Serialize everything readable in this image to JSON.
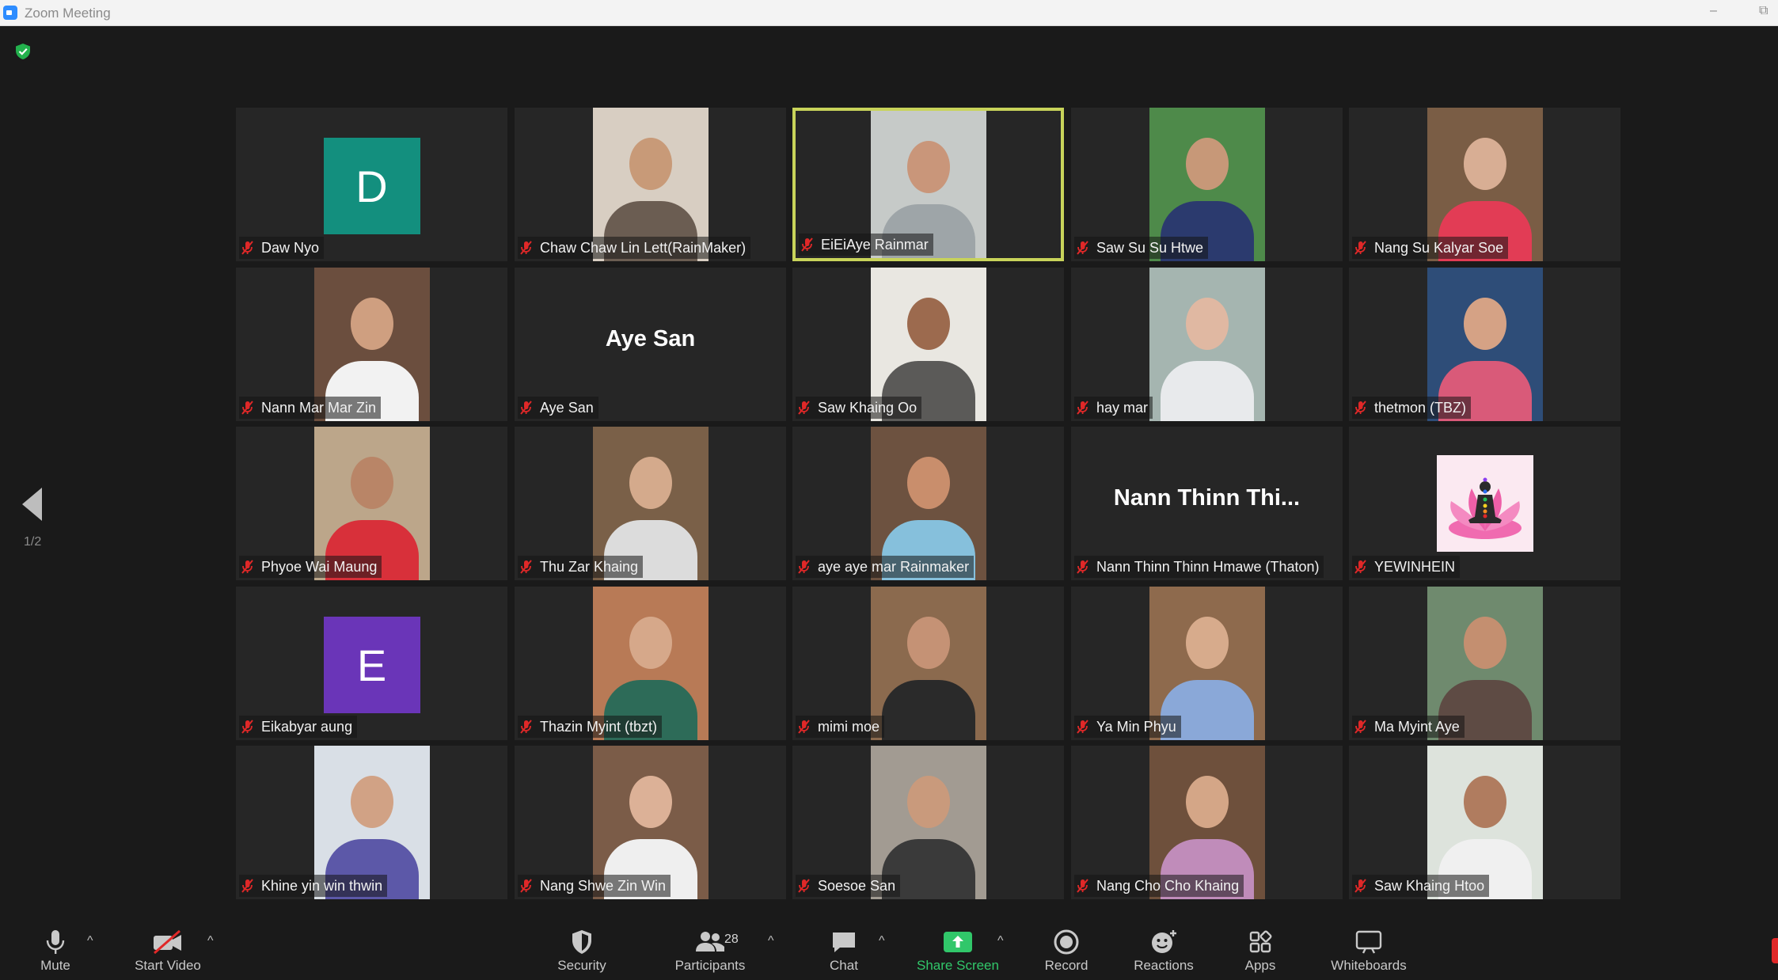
{
  "window": {
    "title": "Zoom Meeting"
  },
  "pager": {
    "page_text": "1/2"
  },
  "participants": [
    {
      "name": "Daw Nyo",
      "type": "avatar",
      "initial": "D",
      "color": "#138f7e"
    },
    {
      "name": "Chaw Chaw Lin Lett(RainMaker)",
      "type": "video",
      "bg": "#d8cec2",
      "skin": "#c89a78",
      "shirt": "#6b5d52"
    },
    {
      "name": "EiEiAye Rainmar",
      "type": "video",
      "bg": "#c6cac8",
      "skin": "#c9967a",
      "shirt": "#9ea5a8",
      "active": true
    },
    {
      "name": "Saw Su Su Htwe",
      "type": "video",
      "bg": "#4e8a4a",
      "skin": "#c79878",
      "shirt": "#2b3a6e"
    },
    {
      "name": "Nang Su Kalyar Soe",
      "type": "video",
      "bg": "#7a5d45",
      "skin": "#d8ae94",
      "shirt": "#e23c55"
    },
    {
      "name": "Nann Mar Mar Zin",
      "type": "video",
      "bg": "#6b4e3e",
      "skin": "#cf9f80",
      "shirt": "#f2f2f2"
    },
    {
      "name": "Aye San",
      "type": "text",
      "big": "Aye San"
    },
    {
      "name": "Saw Khaing Oo",
      "type": "video",
      "bg": "#e9e7e1",
      "skin": "#9c6a4e",
      "shirt": "#5b5a58"
    },
    {
      "name": "hay mar",
      "type": "video",
      "bg": "#a5b5b0",
      "skin": "#e0b8a2",
      "shirt": "#e8eaec"
    },
    {
      "name": "thetmon (TBZ)",
      "type": "video",
      "bg": "#2e4d78",
      "skin": "#d5a285",
      "shirt": "#d95a79"
    },
    {
      "name": "Phyoe Wai Maung",
      "type": "video",
      "bg": "#bca68a",
      "skin": "#b98567",
      "shirt": "#d8303a"
    },
    {
      "name": "Thu Zar Khaing",
      "type": "video",
      "bg": "#7a6048",
      "skin": "#d4aa8c",
      "shirt": "#dcdcdc"
    },
    {
      "name": "aye aye mar Rainmaker",
      "type": "video",
      "bg": "#6d5240",
      "skin": "#c98e6c",
      "shirt": "#86c0dc"
    },
    {
      "name": "Nann Thinn Thinn Hmawe (Thaton)",
      "type": "text",
      "big": "Nann  Thinn  Thi..."
    },
    {
      "name": "YEWINHEIN",
      "type": "lotus"
    },
    {
      "name": "Eikabyar aung",
      "type": "avatar",
      "initial": "E",
      "color": "#6a35b8"
    },
    {
      "name": "Thazin Myint (tbzt)",
      "type": "video",
      "bg": "#b87a56",
      "skin": "#d6a88a",
      "shirt": "#2d6b58"
    },
    {
      "name": "mimi moe",
      "type": "video",
      "bg": "#8b6a4e",
      "skin": "#c59275",
      "shirt": "#2a2a2a"
    },
    {
      "name": "Ya Min Phyu",
      "type": "video",
      "bg": "#8e6a4d",
      "skin": "#d7ab8c",
      "shirt": "#8aa8d8"
    },
    {
      "name": "Ma Myint Aye",
      "type": "video",
      "bg": "#6f8a6e",
      "skin": "#c48f70",
      "shirt": "#5e4b44"
    },
    {
      "name": "Khine yin win thwin",
      "type": "video",
      "bg": "#d9dfe6",
      "skin": "#d1a285",
      "shirt": "#5c58a8"
    },
    {
      "name": "Nang Shwe Zin Win",
      "type": "video",
      "bg": "#7b5c48",
      "skin": "#dcb197",
      "shirt": "#efefef"
    },
    {
      "name": "Soesoe San",
      "type": "video",
      "bg": "#a29b92",
      "skin": "#c99a7c",
      "shirt": "#3a3a3a"
    },
    {
      "name": "Nang Cho Cho Khaing",
      "type": "video",
      "bg": "#6e503c",
      "skin": "#d4a687",
      "shirt": "#c08cba"
    },
    {
      "name": "Saw Khaing Htoo",
      "type": "video",
      "bg": "#dde3dc",
      "skin": "#b07c5f",
      "shirt": "#f0f0f0"
    }
  ],
  "toolbar": {
    "mute": "Mute",
    "start_video": "Start Video",
    "security": "Security",
    "participants": "Participants",
    "participants_count": "28",
    "chat": "Chat",
    "share_screen": "Share Screen",
    "record": "Record",
    "reactions": "Reactions",
    "apps": "Apps",
    "whiteboards": "Whiteboards"
  },
  "colors": {
    "share_green": "#31c76a",
    "active_speaker": "#c8d35a",
    "mic_muted": "#e02828"
  }
}
